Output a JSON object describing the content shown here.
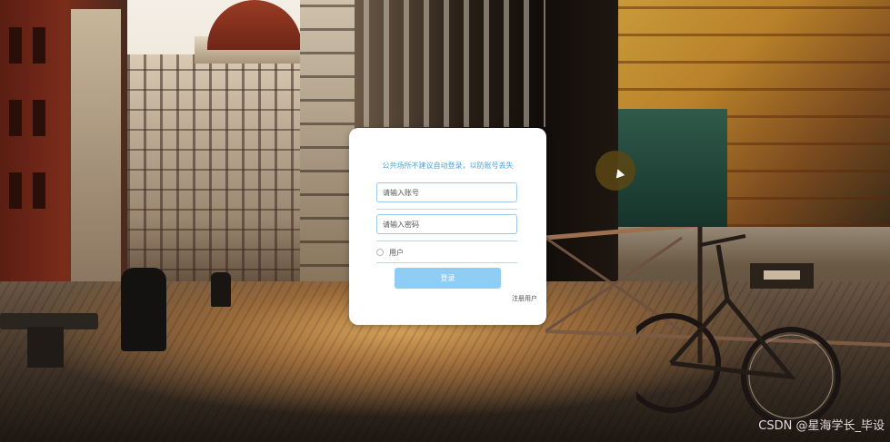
{
  "login": {
    "tip": "公共场所不建议自动登录，以防账号丢失",
    "username_placeholder": "请输入账号",
    "password_placeholder": "请输入密码",
    "role_option": "用户",
    "login_button": "登录",
    "register_link": "注册用户"
  },
  "watermark": "CSDN @星海学长_毕设",
  "colors": {
    "accent": "#4aa3df",
    "button_bg": "#8fcdf5",
    "field_border": "#9cc9ea",
    "card_bg": "#ffffff"
  }
}
